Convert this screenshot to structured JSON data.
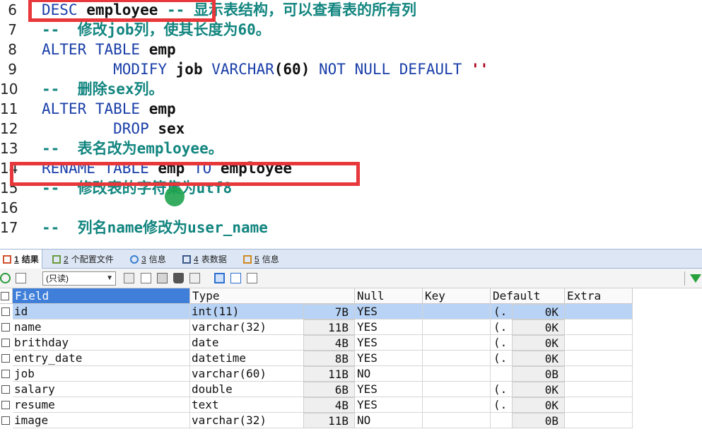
{
  "editor": {
    "lines": [
      {
        "num": "6",
        "parts": [
          {
            "t": "DESC ",
            "c": "kw"
          },
          {
            "t": "employee ",
            "c": "id"
          },
          {
            "t": "-- ",
            "c": "cmt"
          },
          {
            "t": "显示表结构，可以查看表的所有列",
            "c": "cmt"
          }
        ]
      },
      {
        "num": "7",
        "parts": [
          {
            "t": "--  ",
            "c": "cmt"
          },
          {
            "t": "修改job列，使其长度为60。",
            "c": "cmt"
          }
        ]
      },
      {
        "num": "8",
        "parts": [
          {
            "t": "ALTER TABLE ",
            "c": "kw"
          },
          {
            "t": "emp",
            "c": "id"
          }
        ]
      },
      {
        "num": "9",
        "parts": [
          {
            "t": "        MODIFY ",
            "c": "kw"
          },
          {
            "t": "job ",
            "c": "id"
          },
          {
            "t": "VARCHAR",
            "c": "kw"
          },
          {
            "t": "(",
            "c": "paren"
          },
          {
            "t": "60",
            "c": "num"
          },
          {
            "t": ") ",
            "c": "paren"
          },
          {
            "t": "NOT NULL DEFAULT ",
            "c": "kw"
          },
          {
            "t": "''",
            "c": "str"
          }
        ]
      },
      {
        "num": "10",
        "parts": [
          {
            "t": "--  ",
            "c": "cmt"
          },
          {
            "t": "删除sex列。",
            "c": "cmt"
          }
        ]
      },
      {
        "num": "11",
        "parts": [
          {
            "t": "ALTER TABLE ",
            "c": "kw"
          },
          {
            "t": "emp",
            "c": "id"
          }
        ]
      },
      {
        "num": "12",
        "parts": [
          {
            "t": "        DROP ",
            "c": "kw"
          },
          {
            "t": "sex",
            "c": "id"
          }
        ]
      },
      {
        "num": "13",
        "parts": [
          {
            "t": "--  ",
            "c": "cmt"
          },
          {
            "t": "表名改为employee。",
            "c": "cmt"
          }
        ]
      },
      {
        "num": "14",
        "parts": [
          {
            "t": "RENAME TABLE ",
            "c": "kw"
          },
          {
            "t": "emp ",
            "c": "id"
          },
          {
            "t": "TO ",
            "c": "kw"
          },
          {
            "t": "employee",
            "c": "id"
          }
        ]
      },
      {
        "num": "15",
        "parts": [
          {
            "t": "--  ",
            "c": "cmt"
          },
          {
            "t": "修改表的字符集为utf8",
            "c": "cmt"
          }
        ]
      },
      {
        "num": "16",
        "parts": []
      },
      {
        "num": "17",
        "parts": [
          {
            "t": "--  ",
            "c": "cmt"
          },
          {
            "t": "列名name修改为user_name",
            "c": "cmt"
          }
        ]
      }
    ]
  },
  "tabs": [
    {
      "num": "1",
      "label": "结果",
      "active": true,
      "icon": "result-grid-icon"
    },
    {
      "num": "2",
      "label": "个配置文件",
      "active": false,
      "icon": "profile-icon"
    },
    {
      "num": "3",
      "label": "信息",
      "active": false,
      "icon": "info-circle-icon"
    },
    {
      "num": "4",
      "label": "表数据",
      "active": false,
      "icon": "table-data-icon"
    },
    {
      "num": "5",
      "label": "信息",
      "active": false,
      "icon": "info-chart-icon"
    }
  ],
  "toolbar": {
    "mode_value": "(只读)"
  },
  "grid": {
    "columns": [
      "Field",
      "Type",
      "Null",
      "Key",
      "Default",
      "Extra"
    ],
    "rows": [
      {
        "field": "id",
        "type": "int(11)",
        "size": "7B",
        "null": "YES",
        "key": "",
        "paren": "(.",
        "default": "0K",
        "extra": "",
        "selected": true
      },
      {
        "field": "name",
        "type": "varchar(32)",
        "size": "11B",
        "null": "YES",
        "key": "",
        "paren": "(.",
        "default": "0K",
        "extra": ""
      },
      {
        "field": "brithday",
        "type": "date",
        "size": "4B",
        "null": "YES",
        "key": "",
        "paren": "(.",
        "default": "0K",
        "extra": ""
      },
      {
        "field": "entry_date",
        "type": "datetime",
        "size": "8B",
        "null": "YES",
        "key": "",
        "paren": "(.",
        "default": "0K",
        "extra": ""
      },
      {
        "field": "job",
        "type": "varchar(60)",
        "size": "11B",
        "null": "NO",
        "key": "",
        "paren": "",
        "default": "0B",
        "extra": ""
      },
      {
        "field": "salary",
        "type": "double",
        "size": "6B",
        "null": "YES",
        "key": "",
        "paren": "(.",
        "default": "0K",
        "extra": ""
      },
      {
        "field": "resume",
        "type": "text",
        "size": "4B",
        "null": "YES",
        "key": "",
        "paren": "(.",
        "default": "0K",
        "extra": ""
      },
      {
        "field": "image",
        "type": "varchar(32)",
        "size": "11B",
        "null": "NO",
        "key": "",
        "paren": "",
        "default": "0B",
        "extra": ""
      }
    ]
  },
  "colors": {
    "highlight_box": "#e8373b",
    "keyword": "#1a3fa8",
    "comment": "#12857f",
    "selection": "#b8d3f5"
  }
}
